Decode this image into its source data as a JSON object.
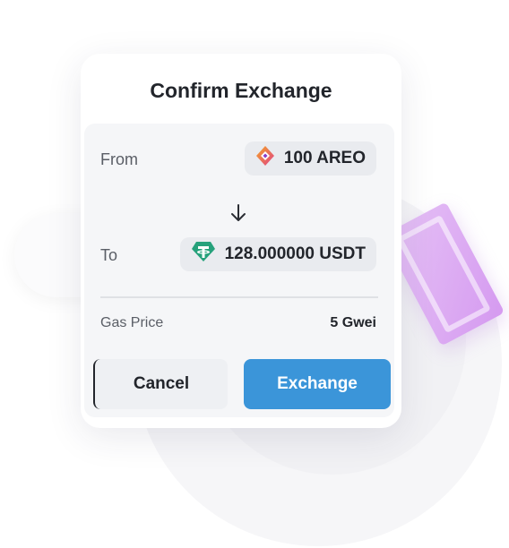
{
  "dialog": {
    "title": "Confirm Exchange",
    "from": {
      "label": "From",
      "amount": "100 AREO",
      "icon": "areo-token-icon"
    },
    "to": {
      "label": "To",
      "amount": "128.000000 USDT",
      "icon": "tether-token-icon"
    },
    "gas": {
      "label": "Gas Price",
      "value": "5 Gwei"
    },
    "buttons": {
      "cancel": "Cancel",
      "exchange": "Exchange"
    }
  },
  "colors": {
    "accent": "#3b95d9",
    "tether": "#26a17b",
    "areo_orange": "#f5a623",
    "areo_pink": "#e0418a"
  }
}
